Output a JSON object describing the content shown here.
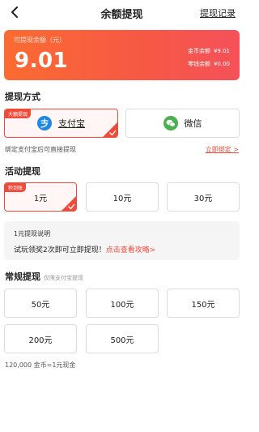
{
  "header": {
    "title": "余额提现",
    "history_label": "提现记录"
  },
  "balance_card": {
    "label": "可提现余额（元）",
    "amount": "9.01",
    "coin_label": "金币余额",
    "coin_value": "¥9.01",
    "change_label": "零钱余额",
    "change_value": "¥0.00"
  },
  "method_section": {
    "title": "提现方式",
    "methods": [
      {
        "name": "支付宝",
        "tag": "大额提现",
        "selected": true,
        "icon": "alipay-icon",
        "color": "#1e88e5"
      },
      {
        "name": "微信",
        "tag": "",
        "selected": false,
        "icon": "wechat-icon",
        "color": "#4caf50"
      }
    ],
    "bind_note": "绑定支付宝后可直接提现",
    "bind_link": "立即绑定 >"
  },
  "activity_section": {
    "title": "活动提现",
    "amounts": [
      {
        "label": "1元",
        "tag": "秒到账",
        "selected": true
      },
      {
        "label": "10元",
        "tag": "",
        "selected": false
      },
      {
        "label": "30元",
        "tag": "",
        "selected": false
      }
    ]
  },
  "info_box": {
    "line1": "1元提现说明",
    "line2_prefix": "试玩领奖2次即可立即提现！",
    "line2_link": "点击查看攻略>"
  },
  "regular_section": {
    "title": "常规提现",
    "subtitle": "仅限支付宝提现",
    "amounts": [
      "50元",
      "100元",
      "150元",
      "200元",
      "500元"
    ],
    "rate_note": "120,000 金币=1元现金"
  },
  "colors": {
    "accent": "#f04a3a",
    "card_gradient_start": "#fb6b32",
    "card_gradient_end": "#f5515a"
  }
}
